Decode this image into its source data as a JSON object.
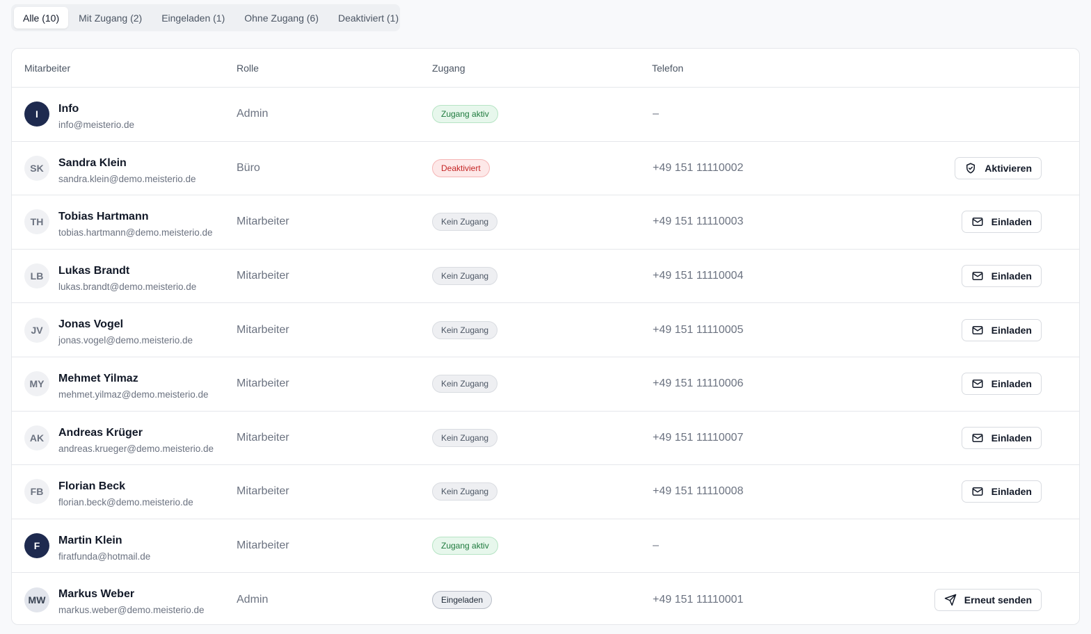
{
  "tabs": [
    {
      "label": "Alle (10)",
      "active": true
    },
    {
      "label": "Mit Zugang (2)",
      "active": false
    },
    {
      "label": "Eingeladen (1)",
      "active": false
    },
    {
      "label": "Ohne Zugang (6)",
      "active": false
    },
    {
      "label": "Deaktiviert (1)",
      "active": false
    }
  ],
  "table": {
    "headers": {
      "employee": "Mitarbeiter",
      "role": "Rolle",
      "access": "Zugang",
      "phone": "Telefon"
    },
    "rows": [
      {
        "initials": "I",
        "avatar_style": "dark",
        "name": "Info",
        "email": "info@meisterio.de",
        "role": "Admin",
        "status": "Zugang aktiv",
        "status_style": "green",
        "phone": "–",
        "action": null,
        "action_icon": null
      },
      {
        "initials": "SK",
        "avatar_style": "light",
        "name": "Sandra Klein",
        "email": "sandra.klein@demo.meisterio.de",
        "role": "Büro",
        "status": "Deaktiviert",
        "status_style": "red",
        "phone": "+49 151 11110002",
        "action": "Aktivieren",
        "action_icon": "shield-check-icon"
      },
      {
        "initials": "TH",
        "avatar_style": "light",
        "name": "Tobias Hartmann",
        "email": "tobias.hartmann@demo.meisterio.de",
        "role": "Mitarbeiter",
        "status": "Kein Zugang",
        "status_style": "gray",
        "phone": "+49 151 11110003",
        "action": "Einladen",
        "action_icon": "mail-icon"
      },
      {
        "initials": "LB",
        "avatar_style": "light",
        "name": "Lukas Brandt",
        "email": "lukas.brandt@demo.meisterio.de",
        "role": "Mitarbeiter",
        "status": "Kein Zugang",
        "status_style": "gray",
        "phone": "+49 151 11110004",
        "action": "Einladen",
        "action_icon": "mail-icon"
      },
      {
        "initials": "JV",
        "avatar_style": "light",
        "name": "Jonas Vogel",
        "email": "jonas.vogel@demo.meisterio.de",
        "role": "Mitarbeiter",
        "status": "Kein Zugang",
        "status_style": "gray",
        "phone": "+49 151 11110005",
        "action": "Einladen",
        "action_icon": "mail-icon"
      },
      {
        "initials": "MY",
        "avatar_style": "light",
        "name": "Mehmet Yilmaz",
        "email": "mehmet.yilmaz@demo.meisterio.de",
        "role": "Mitarbeiter",
        "status": "Kein Zugang",
        "status_style": "gray",
        "phone": "+49 151 11110006",
        "action": "Einladen",
        "action_icon": "mail-icon"
      },
      {
        "initials": "AK",
        "avatar_style": "light",
        "name": "Andreas Krüger",
        "email": "andreas.krueger@demo.meisterio.de",
        "role": "Mitarbeiter",
        "status": "Kein Zugang",
        "status_style": "gray",
        "phone": "+49 151 11110007",
        "action": "Einladen",
        "action_icon": "mail-icon"
      },
      {
        "initials": "FB",
        "avatar_style": "light",
        "name": "Florian Beck",
        "email": "florian.beck@demo.meisterio.de",
        "role": "Mitarbeiter",
        "status": "Kein Zugang",
        "status_style": "gray",
        "phone": "+49 151 11110008",
        "action": "Einladen",
        "action_icon": "mail-icon"
      },
      {
        "initials": "F",
        "avatar_style": "dark",
        "name": "Martin Klein",
        "email": "firatfunda@hotmail.de",
        "role": "Mitarbeiter",
        "status": "Zugang aktiv",
        "status_style": "green",
        "phone": "–",
        "action": null,
        "action_icon": null
      },
      {
        "initials": "MW",
        "avatar_style": "mid",
        "name": "Markus Weber",
        "email": "markus.weber@demo.meisterio.de",
        "role": "Admin",
        "status": "Eingeladen",
        "status_style": "invited",
        "phone": "+49 151 11110001",
        "action": "Erneut senden",
        "action_icon": "send-icon"
      }
    ]
  }
}
